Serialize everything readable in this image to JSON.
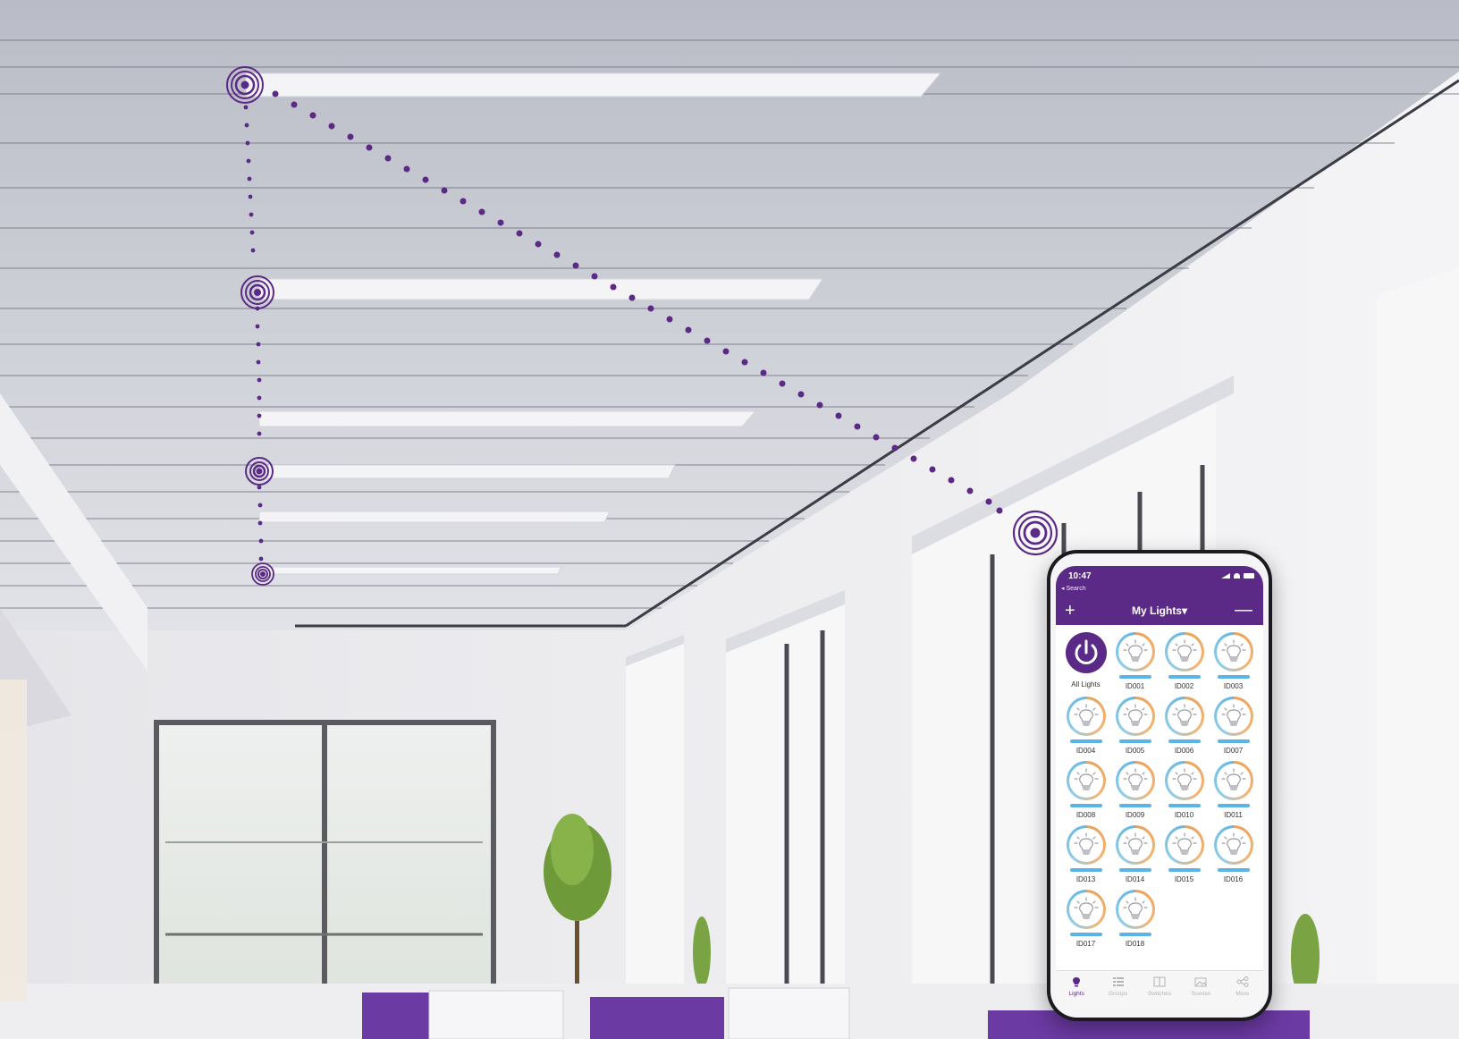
{
  "colors": {
    "brand": "#5b2a86",
    "bulb_warm": "#f3b576",
    "bulb_cool": "#67b6e0",
    "level_bar": "#5ab4e5"
  },
  "status_bar": {
    "time": "10:47",
    "back_label": "◂ Search"
  },
  "nav": {
    "title": "My Lights▾",
    "add_icon": "plus-icon",
    "remove_icon": "minus-icon"
  },
  "all_lights": {
    "label": "All Lights",
    "icon": "power-icon"
  },
  "lights": [
    {
      "label": "ID001"
    },
    {
      "label": "ID002"
    },
    {
      "label": "ID003"
    },
    {
      "label": "ID004"
    },
    {
      "label": "ID005"
    },
    {
      "label": "ID006"
    },
    {
      "label": "ID007"
    },
    {
      "label": "ID008"
    },
    {
      "label": "ID009"
    },
    {
      "label": "ID010"
    },
    {
      "label": "ID011"
    },
    {
      "label": "ID013"
    },
    {
      "label": "ID014"
    },
    {
      "label": "ID015"
    },
    {
      "label": "ID016"
    },
    {
      "label": "ID017"
    },
    {
      "label": "ID018"
    }
  ],
  "tabs": [
    {
      "label": "Lights",
      "icon": "bulb-icon",
      "active": true
    },
    {
      "label": "Groups",
      "icon": "groups-icon",
      "active": false
    },
    {
      "label": "Switches",
      "icon": "switches-icon",
      "active": false
    },
    {
      "label": "Scenes",
      "icon": "scenes-icon",
      "active": false
    },
    {
      "label": "More",
      "icon": "share-icon",
      "active": false
    }
  ]
}
